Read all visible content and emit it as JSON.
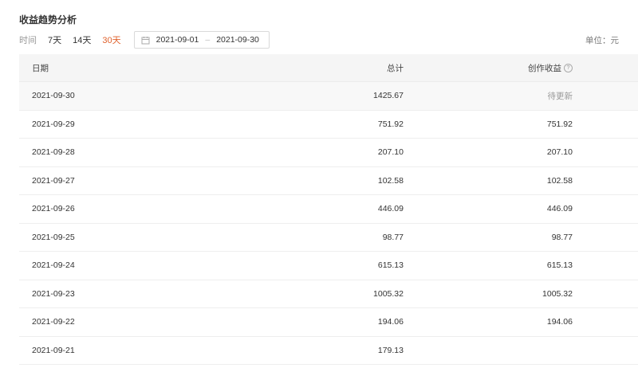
{
  "title": "收益趋势分析",
  "filter": {
    "label": "时间",
    "ranges": [
      "7天",
      "14天",
      "30天"
    ],
    "active_range": "30天",
    "start_date": "2021-09-01",
    "separator": "–",
    "end_date": "2021-09-30"
  },
  "unit_label": "单位：元",
  "table": {
    "columns": [
      "日期",
      "总计",
      "创作收益"
    ],
    "help_icon": "?",
    "rows": [
      {
        "date": "2021-09-30",
        "total": "1425.67",
        "earnings": "待更新"
      },
      {
        "date": "2021-09-29",
        "total": "751.92",
        "earnings": "751.92"
      },
      {
        "date": "2021-09-28",
        "total": "207.10",
        "earnings": "207.10"
      },
      {
        "date": "2021-09-27",
        "total": "102.58",
        "earnings": "102.58"
      },
      {
        "date": "2021-09-26",
        "total": "446.09",
        "earnings": "446.09"
      },
      {
        "date": "2021-09-25",
        "total": "98.77",
        "earnings": "98.77"
      },
      {
        "date": "2021-09-24",
        "total": "615.13",
        "earnings": "615.13"
      },
      {
        "date": "2021-09-23",
        "total": "1005.32",
        "earnings": "1005.32"
      },
      {
        "date": "2021-09-22",
        "total": "194.06",
        "earnings": "194.06"
      },
      {
        "date": "2021-09-21",
        "total": "179.13",
        "earnings": ""
      }
    ]
  },
  "colors": {
    "accent": "#e0622d",
    "header_bg": "#f5f5f5",
    "border": "#eeeeee",
    "muted_text": "#999999"
  },
  "icons": {
    "calendar": "calendar-icon",
    "help": "help-icon"
  }
}
